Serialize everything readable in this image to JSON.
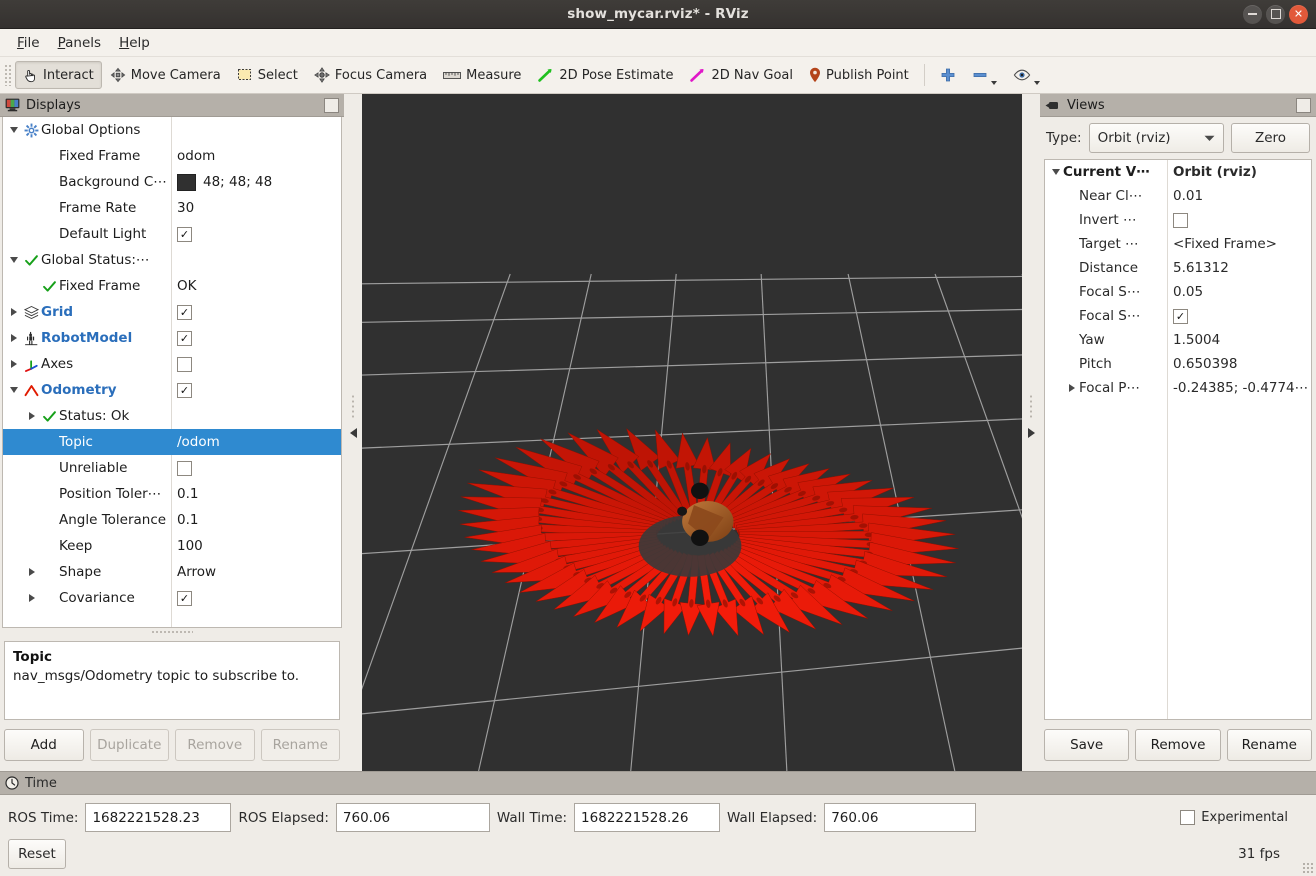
{
  "window": {
    "title": "show_mycar.rviz* - RViz",
    "minimize_label": "−",
    "maximize_label": "□",
    "close_label": "✕"
  },
  "menubar": {
    "items": [
      {
        "label": "File",
        "mnemonic": "F"
      },
      {
        "label": "Panels",
        "mnemonic": "P"
      },
      {
        "label": "Help",
        "mnemonic": "H"
      }
    ]
  },
  "toolbar": {
    "items": [
      {
        "label": "Interact",
        "icon": "hand-cursor-icon",
        "checked": true
      },
      {
        "label": "Move Camera",
        "icon": "move-camera-icon",
        "checked": false
      },
      {
        "label": "Select",
        "icon": "select-rect-icon",
        "checked": false
      },
      {
        "label": "Focus Camera",
        "icon": "focus-camera-icon",
        "checked": false
      },
      {
        "label": "Measure",
        "icon": "ruler-icon",
        "checked": false
      },
      {
        "label": "2D Pose Estimate",
        "icon": "green-arrow-icon",
        "checked": false
      },
      {
        "label": "2D Nav Goal",
        "icon": "magenta-arrow-icon",
        "checked": false
      },
      {
        "label": "Publish Point",
        "icon": "map-pin-icon",
        "checked": false
      }
    ],
    "extra": [
      {
        "icon": "plus-icon",
        "label": ""
      },
      {
        "icon": "minus-icon",
        "label": ""
      },
      {
        "icon": "eye-icon",
        "label": ""
      }
    ]
  },
  "displays": {
    "panel_title": "Displays",
    "panel_icon": "monitor-icon",
    "rows": [
      {
        "label": "Global Options",
        "value": "",
        "indent": 0,
        "expander": "down",
        "icon": "gear-icon",
        "style": "plain",
        "value_type": "none"
      },
      {
        "label": "Fixed Frame",
        "value": "odom",
        "indent": 1,
        "expander": "none",
        "icon": "none",
        "style": "plain",
        "value_type": "text"
      },
      {
        "label": "Background C⋯",
        "value": "48; 48; 48",
        "indent": 1,
        "expander": "none",
        "icon": "none",
        "style": "plain",
        "value_type": "color",
        "color": "#303030"
      },
      {
        "label": "Frame Rate",
        "value": "30",
        "indent": 1,
        "expander": "none",
        "icon": "none",
        "style": "plain",
        "value_type": "text"
      },
      {
        "label": "Default Light",
        "value": "",
        "indent": 1,
        "expander": "none",
        "icon": "none",
        "style": "plain",
        "value_type": "checkbox",
        "checked": true
      },
      {
        "label": "Global Status:⋯",
        "value": "",
        "indent": 0,
        "expander": "down",
        "icon": "check-green-icon",
        "style": "plain",
        "value_type": "none"
      },
      {
        "label": "Fixed Frame",
        "value": "OK",
        "indent": 1,
        "expander": "none",
        "icon": "check-green-icon",
        "style": "plain",
        "value_type": "text"
      },
      {
        "label": "Grid",
        "value": "",
        "indent": 0,
        "expander": "right",
        "icon": "grid-icon",
        "style": "blue",
        "value_type": "checkbox",
        "checked": true
      },
      {
        "label": "RobotModel",
        "value": "",
        "indent": 0,
        "expander": "right",
        "icon": "robot-icon",
        "style": "blue",
        "value_type": "checkbox",
        "checked": true
      },
      {
        "label": "Axes",
        "value": "",
        "indent": 0,
        "expander": "right",
        "icon": "axes-icon",
        "style": "plain",
        "value_type": "checkbox",
        "checked": false
      },
      {
        "label": "Odometry",
        "value": "",
        "indent": 0,
        "expander": "down",
        "icon": "odometry-icon",
        "style": "blue",
        "value_type": "checkbox",
        "checked": true
      },
      {
        "label": "Status: Ok",
        "value": "",
        "indent": 1,
        "expander": "right",
        "icon": "check-green-icon",
        "style": "plain",
        "value_type": "none"
      },
      {
        "label": "Topic",
        "value": "/odom",
        "indent": 1,
        "expander": "none",
        "icon": "none",
        "style": "plain",
        "value_type": "text",
        "selected": true
      },
      {
        "label": "Unreliable",
        "value": "",
        "indent": 1,
        "expander": "none",
        "icon": "none",
        "style": "plain",
        "value_type": "checkbox",
        "checked": false
      },
      {
        "label": "Position Toler⋯",
        "value": "0.1",
        "indent": 1,
        "expander": "none",
        "icon": "none",
        "style": "plain",
        "value_type": "text"
      },
      {
        "label": "Angle Tolerance",
        "value": "0.1",
        "indent": 1,
        "expander": "none",
        "icon": "none",
        "style": "plain",
        "value_type": "text"
      },
      {
        "label": "Keep",
        "value": "100",
        "indent": 1,
        "expander": "none",
        "icon": "none",
        "style": "plain",
        "value_type": "text"
      },
      {
        "label": "Shape",
        "value": "Arrow",
        "indent": 1,
        "expander": "right",
        "icon": "none",
        "style": "plain",
        "value_type": "text"
      },
      {
        "label": "Covariance",
        "value": "",
        "indent": 1,
        "expander": "right",
        "icon": "none",
        "style": "plain",
        "value_type": "checkbox",
        "checked": true
      }
    ],
    "description": {
      "title": "Topic",
      "body": "nav_msgs/Odometry topic to subscribe to."
    },
    "buttons": [
      {
        "label": "Add",
        "enabled": true
      },
      {
        "label": "Duplicate",
        "enabled": false
      },
      {
        "label": "Remove",
        "enabled": false
      },
      {
        "label": "Rename",
        "enabled": false
      }
    ]
  },
  "views": {
    "panel_title": "Views",
    "panel_icon": "camera-icon",
    "type_label": "Type:",
    "type_value": "Orbit (rviz)",
    "zero_label": "Zero",
    "rows": [
      {
        "label": "Current V⋯",
        "value": "Orbit (rviz)",
        "indent": 0,
        "expander": "down",
        "bold": true,
        "value_type": "text"
      },
      {
        "label": "Near Cl⋯",
        "value": "0.01",
        "indent": 1,
        "expander": "none",
        "bold": false,
        "value_type": "text"
      },
      {
        "label": "Invert ⋯",
        "value": "",
        "indent": 1,
        "expander": "none",
        "bold": false,
        "value_type": "checkbox",
        "checked": false
      },
      {
        "label": "Target ⋯",
        "value": "<Fixed Frame>",
        "indent": 1,
        "expander": "none",
        "bold": false,
        "value_type": "text"
      },
      {
        "label": "Distance",
        "value": "5.61312",
        "indent": 1,
        "expander": "none",
        "bold": false,
        "value_type": "text"
      },
      {
        "label": "Focal S⋯",
        "value": "0.05",
        "indent": 1,
        "expander": "none",
        "bold": false,
        "value_type": "text"
      },
      {
        "label": "Focal S⋯",
        "value": "",
        "indent": 1,
        "expander": "none",
        "bold": false,
        "value_type": "checkbox",
        "checked": true
      },
      {
        "label": "Yaw",
        "value": "1.5004",
        "indent": 1,
        "expander": "none",
        "bold": false,
        "value_type": "text"
      },
      {
        "label": "Pitch",
        "value": "0.650398",
        "indent": 1,
        "expander": "none",
        "bold": false,
        "value_type": "text"
      },
      {
        "label": "Focal P⋯",
        "value": "-0.24385; -0.4774⋯",
        "indent": 1,
        "expander": "right",
        "bold": false,
        "value_type": "text"
      }
    ],
    "buttons": [
      {
        "label": "Save"
      },
      {
        "label": "Remove"
      },
      {
        "label": "Rename"
      }
    ]
  },
  "time": {
    "panel_title": "Time",
    "panel_icon": "clock-icon",
    "fields": [
      {
        "label": "ROS Time:",
        "value": "1682221528.23"
      },
      {
        "label": "ROS Elapsed:",
        "value": "760.06"
      },
      {
        "label": "Wall Time:",
        "value": "1682221528.26"
      },
      {
        "label": "Wall Elapsed:",
        "value": "760.06"
      }
    ],
    "experimental_label": "Experimental",
    "experimental_checked": false,
    "reset_label": "Reset",
    "fps": "31 fps"
  },
  "viewport": {
    "background_color": "#303030",
    "grid_color": "#a8a8a8",
    "arrow_color": "#e01b00",
    "robot_color": "#a05a28",
    "arrow_count": 54
  }
}
